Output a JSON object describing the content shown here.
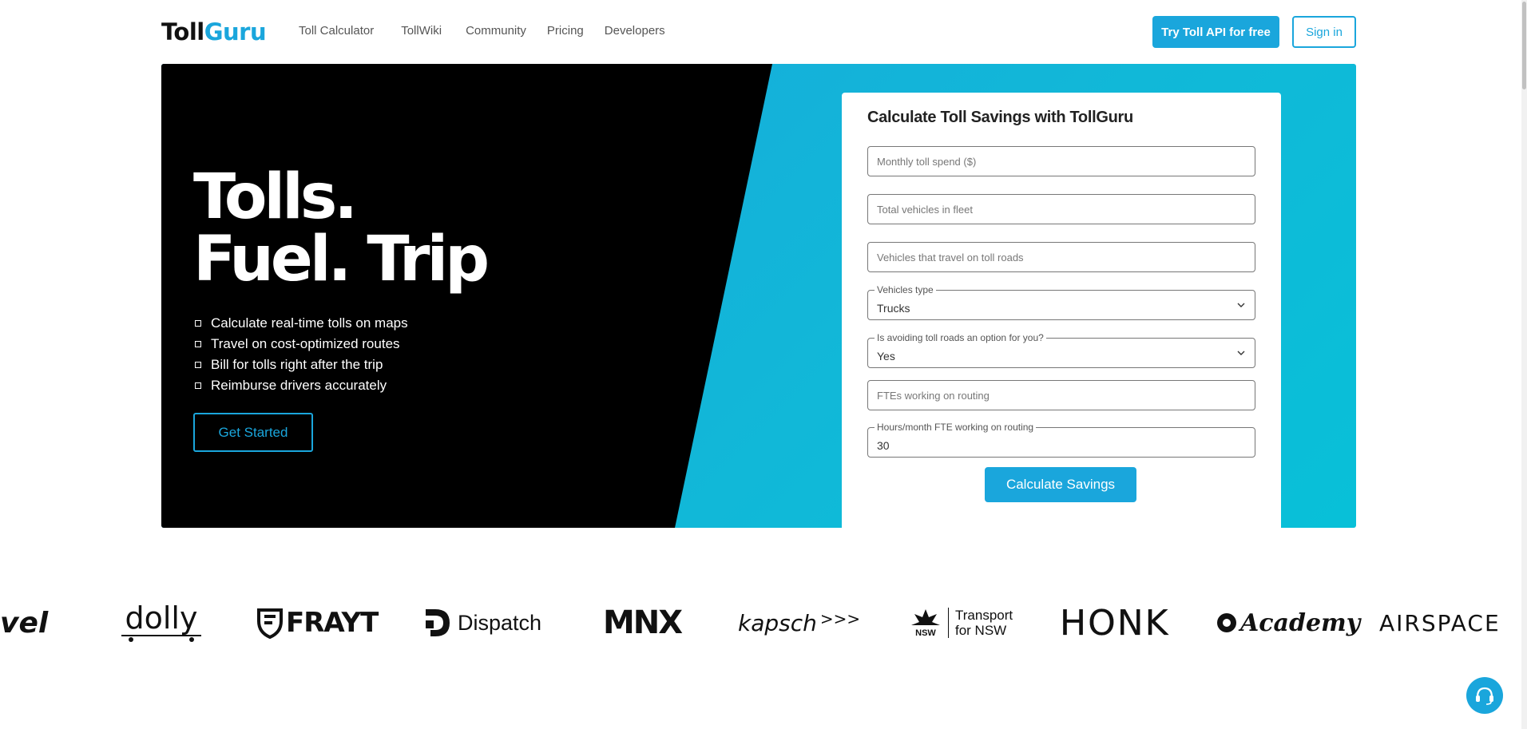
{
  "header": {
    "logo_part1": "Toll",
    "logo_part2": "Guru",
    "nav": [
      "Toll Calculator",
      "TollWiki",
      "Community",
      "Pricing",
      "Developers"
    ],
    "try_api_label": "Try Toll API for free",
    "signin_label": "Sign in"
  },
  "hero": {
    "title_line1": "Tolls.",
    "title_line2": "Fuel. Trip",
    "bullets": [
      "Calculate real-time tolls on maps",
      "Travel on cost-optimized routes",
      "Bill for tolls right after the trip",
      "Reimburse drivers accurately"
    ],
    "get_started_label": "Get Started"
  },
  "form": {
    "title": "Calculate Toll Savings with TollGuru",
    "monthly_toll_placeholder": "Monthly toll spend ($)",
    "total_vehicles_placeholder": "Total vehicles in fleet",
    "toll_vehicles_placeholder": "Vehicles that travel on toll roads",
    "vehicle_type_label": "Vehicles type",
    "vehicle_type_value": "Trucks",
    "avoid_tolls_label": "Is avoiding toll roads an option for you?",
    "avoid_tolls_value": "Yes",
    "ftes_placeholder": "FTEs working on routing",
    "hours_label": "Hours/month FTE working on routing",
    "hours_value": "30",
    "calculate_label": "Calculate Savings"
  },
  "logos": {
    "l1": "vel",
    "l2": "dolly",
    "l3": "FRAYT",
    "l4": "Dispatch",
    "l5": "MNX",
    "l6": "kapsch",
    "l6_arrows": ">>>",
    "l7a": "Transport",
    "l7b": "for NSW",
    "l7_nsw": "NSW",
    "l8": "HONK",
    "l9": "Academy",
    "l10": "AIRSPACE"
  },
  "colors": {
    "accent": "#1aa6dc",
    "hero_dark": "#000000"
  }
}
